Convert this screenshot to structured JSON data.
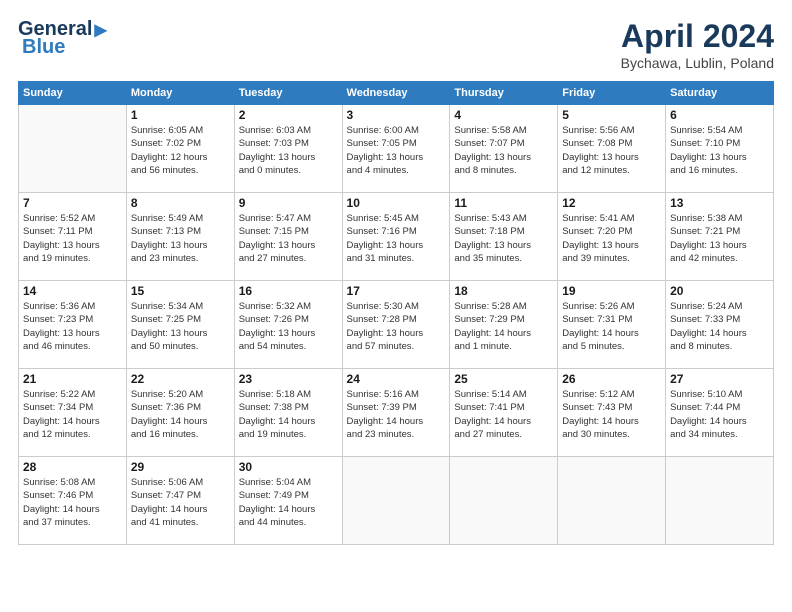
{
  "header": {
    "logo_line1": "General",
    "logo_line2": "Blue",
    "month": "April 2024",
    "location": "Bychawa, Lublin, Poland"
  },
  "weekdays": [
    "Sunday",
    "Monday",
    "Tuesday",
    "Wednesday",
    "Thursday",
    "Friday",
    "Saturday"
  ],
  "weeks": [
    [
      {
        "day": "",
        "info": ""
      },
      {
        "day": "1",
        "info": "Sunrise: 6:05 AM\nSunset: 7:02 PM\nDaylight: 12 hours\nand 56 minutes."
      },
      {
        "day": "2",
        "info": "Sunrise: 6:03 AM\nSunset: 7:03 PM\nDaylight: 13 hours\nand 0 minutes."
      },
      {
        "day": "3",
        "info": "Sunrise: 6:00 AM\nSunset: 7:05 PM\nDaylight: 13 hours\nand 4 minutes."
      },
      {
        "day": "4",
        "info": "Sunrise: 5:58 AM\nSunset: 7:07 PM\nDaylight: 13 hours\nand 8 minutes."
      },
      {
        "day": "5",
        "info": "Sunrise: 5:56 AM\nSunset: 7:08 PM\nDaylight: 13 hours\nand 12 minutes."
      },
      {
        "day": "6",
        "info": "Sunrise: 5:54 AM\nSunset: 7:10 PM\nDaylight: 13 hours\nand 16 minutes."
      }
    ],
    [
      {
        "day": "7",
        "info": "Sunrise: 5:52 AM\nSunset: 7:11 PM\nDaylight: 13 hours\nand 19 minutes."
      },
      {
        "day": "8",
        "info": "Sunrise: 5:49 AM\nSunset: 7:13 PM\nDaylight: 13 hours\nand 23 minutes."
      },
      {
        "day": "9",
        "info": "Sunrise: 5:47 AM\nSunset: 7:15 PM\nDaylight: 13 hours\nand 27 minutes."
      },
      {
        "day": "10",
        "info": "Sunrise: 5:45 AM\nSunset: 7:16 PM\nDaylight: 13 hours\nand 31 minutes."
      },
      {
        "day": "11",
        "info": "Sunrise: 5:43 AM\nSunset: 7:18 PM\nDaylight: 13 hours\nand 35 minutes."
      },
      {
        "day": "12",
        "info": "Sunrise: 5:41 AM\nSunset: 7:20 PM\nDaylight: 13 hours\nand 39 minutes."
      },
      {
        "day": "13",
        "info": "Sunrise: 5:38 AM\nSunset: 7:21 PM\nDaylight: 13 hours\nand 42 minutes."
      }
    ],
    [
      {
        "day": "14",
        "info": "Sunrise: 5:36 AM\nSunset: 7:23 PM\nDaylight: 13 hours\nand 46 minutes."
      },
      {
        "day": "15",
        "info": "Sunrise: 5:34 AM\nSunset: 7:25 PM\nDaylight: 13 hours\nand 50 minutes."
      },
      {
        "day": "16",
        "info": "Sunrise: 5:32 AM\nSunset: 7:26 PM\nDaylight: 13 hours\nand 54 minutes."
      },
      {
        "day": "17",
        "info": "Sunrise: 5:30 AM\nSunset: 7:28 PM\nDaylight: 13 hours\nand 57 minutes."
      },
      {
        "day": "18",
        "info": "Sunrise: 5:28 AM\nSunset: 7:29 PM\nDaylight: 14 hours\nand 1 minute."
      },
      {
        "day": "19",
        "info": "Sunrise: 5:26 AM\nSunset: 7:31 PM\nDaylight: 14 hours\nand 5 minutes."
      },
      {
        "day": "20",
        "info": "Sunrise: 5:24 AM\nSunset: 7:33 PM\nDaylight: 14 hours\nand 8 minutes."
      }
    ],
    [
      {
        "day": "21",
        "info": "Sunrise: 5:22 AM\nSunset: 7:34 PM\nDaylight: 14 hours\nand 12 minutes."
      },
      {
        "day": "22",
        "info": "Sunrise: 5:20 AM\nSunset: 7:36 PM\nDaylight: 14 hours\nand 16 minutes."
      },
      {
        "day": "23",
        "info": "Sunrise: 5:18 AM\nSunset: 7:38 PM\nDaylight: 14 hours\nand 19 minutes."
      },
      {
        "day": "24",
        "info": "Sunrise: 5:16 AM\nSunset: 7:39 PM\nDaylight: 14 hours\nand 23 minutes."
      },
      {
        "day": "25",
        "info": "Sunrise: 5:14 AM\nSunset: 7:41 PM\nDaylight: 14 hours\nand 27 minutes."
      },
      {
        "day": "26",
        "info": "Sunrise: 5:12 AM\nSunset: 7:43 PM\nDaylight: 14 hours\nand 30 minutes."
      },
      {
        "day": "27",
        "info": "Sunrise: 5:10 AM\nSunset: 7:44 PM\nDaylight: 14 hours\nand 34 minutes."
      }
    ],
    [
      {
        "day": "28",
        "info": "Sunrise: 5:08 AM\nSunset: 7:46 PM\nDaylight: 14 hours\nand 37 minutes."
      },
      {
        "day": "29",
        "info": "Sunrise: 5:06 AM\nSunset: 7:47 PM\nDaylight: 14 hours\nand 41 minutes."
      },
      {
        "day": "30",
        "info": "Sunrise: 5:04 AM\nSunset: 7:49 PM\nDaylight: 14 hours\nand 44 minutes."
      },
      {
        "day": "",
        "info": ""
      },
      {
        "day": "",
        "info": ""
      },
      {
        "day": "",
        "info": ""
      },
      {
        "day": "",
        "info": ""
      }
    ]
  ]
}
